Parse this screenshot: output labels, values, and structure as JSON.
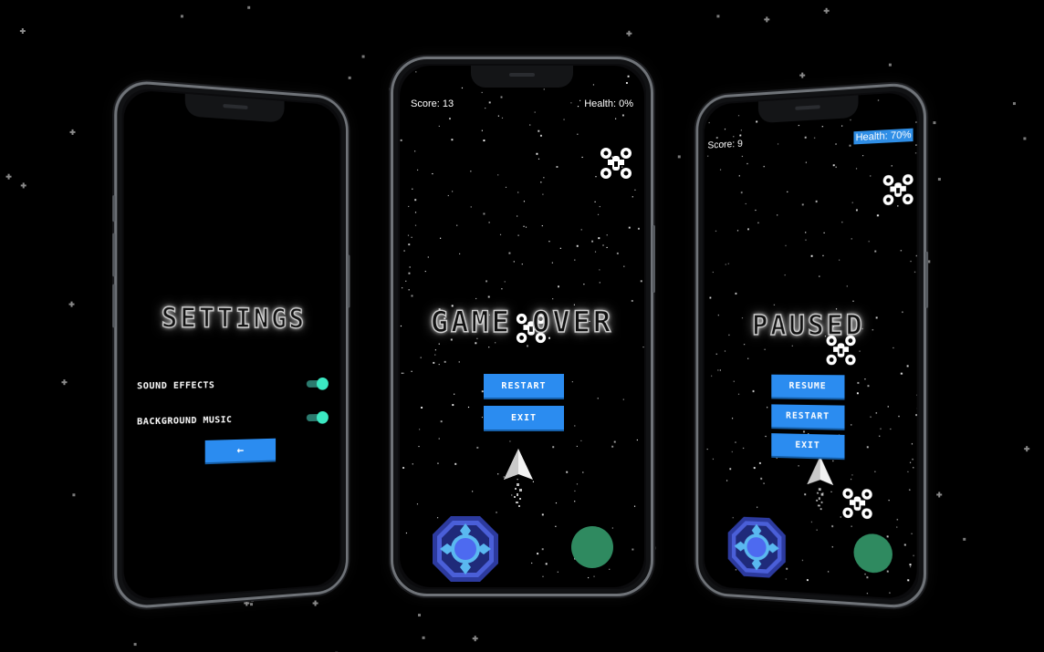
{
  "settings_screen": {
    "title": "SETTINGS",
    "options": [
      {
        "label": "SOUND EFFECTS",
        "enabled": true
      },
      {
        "label": "BACKGROUND MUSIC",
        "enabled": true
      }
    ],
    "back_button": {
      "icon": "arrow-left-icon",
      "glyph": "←"
    }
  },
  "game_over_screen": {
    "score": "Score: 13",
    "health": "Health: 0%",
    "title": "GAME OVER",
    "buttons": {
      "restart": "RESTART",
      "exit": "EXIT"
    }
  },
  "paused_screen": {
    "score": "Score: 9",
    "health": "Health: 70%",
    "title": "PAUSED",
    "buttons": {
      "resume": "RESUME",
      "restart": "RESTART",
      "exit": "EXIT"
    }
  },
  "colors": {
    "button": "#2b8cf0",
    "toggle_on": "#3be8c2",
    "fire_button": "#2f8a60",
    "joystick_outer": "#3a4fd0",
    "joystick_inner": "#4d6af0"
  },
  "icons": [
    "enemy-drone-icon",
    "player-ship-icon",
    "joystick-icon",
    "fire-button-icon",
    "arrow-left-icon"
  ]
}
